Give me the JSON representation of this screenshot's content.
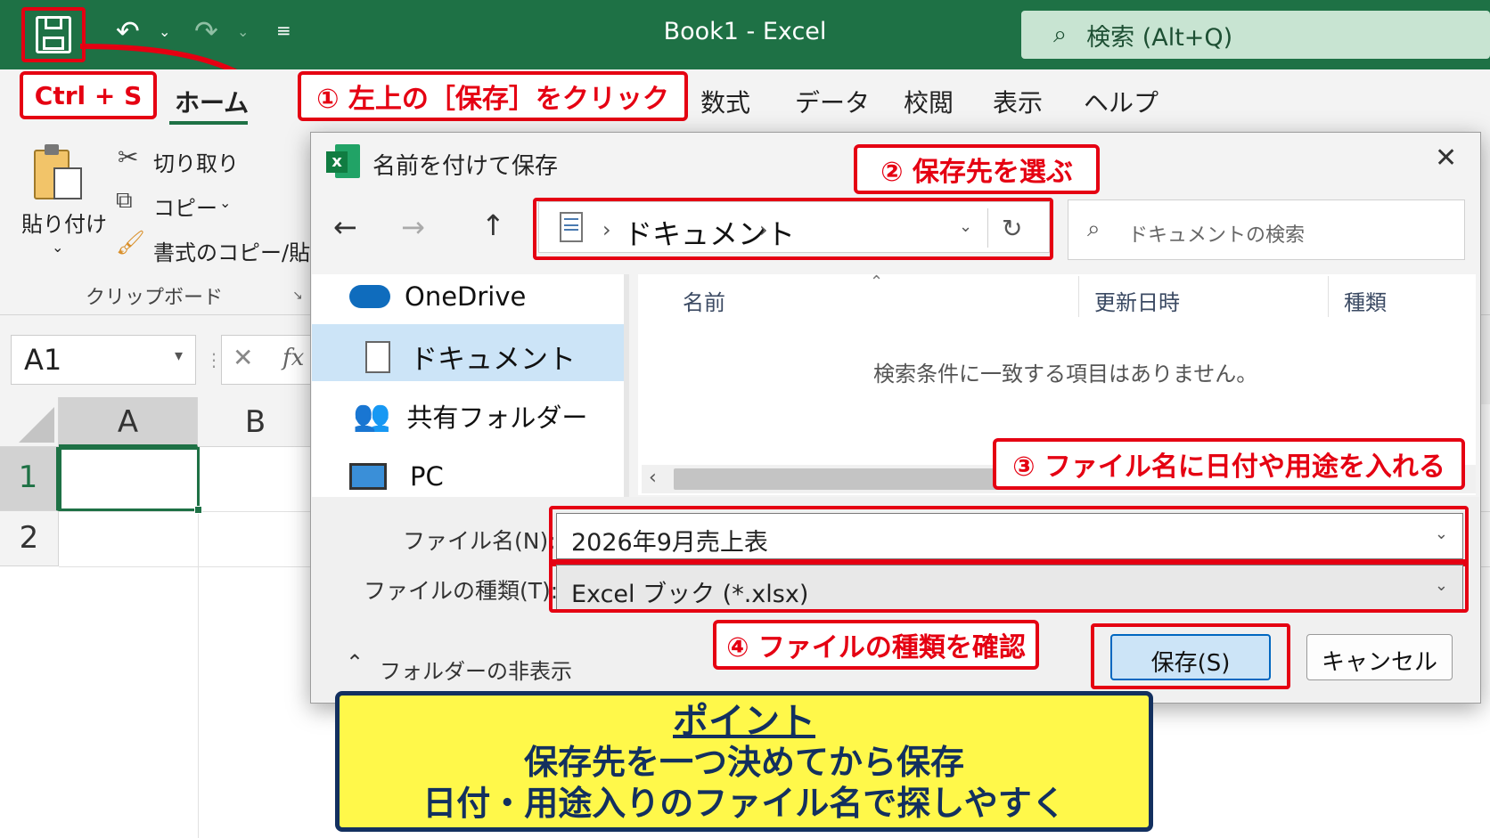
{
  "window": {
    "title": "Book1  -  Excel"
  },
  "search": {
    "label": "検索 (Alt+Q)"
  },
  "shortcut": {
    "label": "Ctrl + S"
  },
  "ribbon_tabs": [
    "ホーム",
    "数式",
    "データ",
    "校閲",
    "表示",
    "ヘルプ"
  ],
  "clipboard": {
    "paste_label": "貼り付け",
    "cut_label": "切り取り",
    "copy_label": "コピー",
    "format_painter_label": "書式のコピー/貼り付け",
    "group_label": "クリップボード"
  },
  "namebox": {
    "value": "A1"
  },
  "formula": {
    "fx": "fx"
  },
  "grid": {
    "columns": [
      "A",
      "B"
    ],
    "rows": [
      "1",
      "2"
    ]
  },
  "dialog": {
    "title": "名前を付けて保存",
    "address": "ドキュメント",
    "search_placeholder": "ドキュメントの検索",
    "nav_items": [
      "OneDrive",
      "ドキュメント",
      "共有フォルダー",
      "PC"
    ],
    "columns": {
      "name": "名前",
      "modified": "更新日時",
      "type": "種類"
    },
    "empty_message": "検索条件に一致する項目はありません。",
    "filename_label": "ファイル名(N):",
    "filename_value": "2026年9月売上表",
    "filetype_label": "ファイルの種類(T):",
    "filetype_value": "Excel ブック (*.xlsx)",
    "hide_folders": "フォルダーの非表示",
    "save_label": "保存(S)",
    "cancel_label": "キャンセル"
  },
  "callouts": {
    "step1": "① 左上の［保存］をクリック",
    "step2": "② 保存先を選ぶ",
    "step3": "③ ファイル名に日付や用途を入れる",
    "step4": "④ ファイルの種類を確認"
  },
  "point": {
    "heading": "ポイント",
    "line1": "保存先を一つ決めてから保存",
    "line2": "日付・用途入りのファイル名で探しやすく"
  },
  "colors": {
    "excel_green": "#1e7145",
    "callout_red": "#e50012",
    "point_yellow": "#fff84a",
    "point_navy": "#13305f",
    "selection_blue": "#cce4f7"
  }
}
